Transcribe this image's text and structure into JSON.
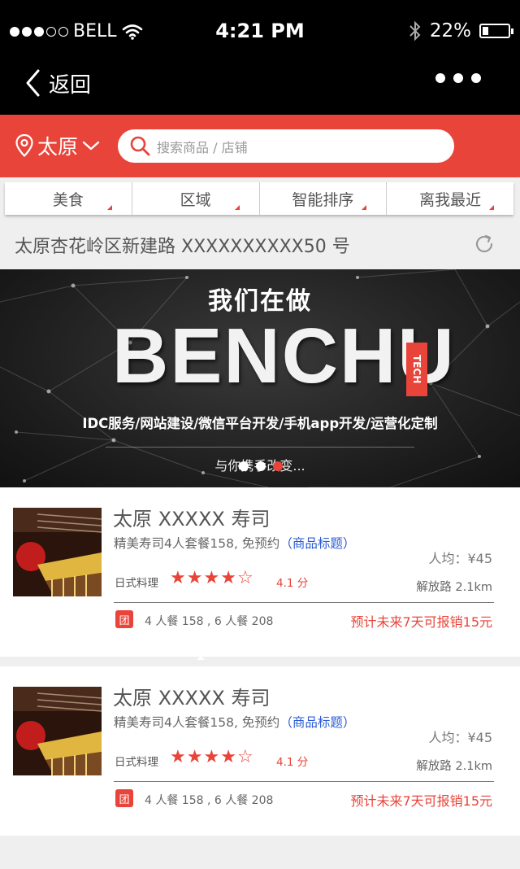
{
  "status_bar": {
    "carrier": "BELL",
    "time": "4:21 PM",
    "battery": "22%",
    "battery_level": 0.22
  },
  "nav": {
    "back_label": "返回"
  },
  "header": {
    "city": "太原",
    "search_placeholder": "搜索商品 / 店铺",
    "accent_color": "#e8443a"
  },
  "filters": [
    "美食",
    "区域",
    "智能排序",
    "离我最近"
  ],
  "address": "太原杏花岭区新建路 XXXXXXXXXX50 号",
  "banner": {
    "headline": "我们在做",
    "logo": "BENCHU",
    "logo_tag": "TECH",
    "services": "IDC服务/网站建设/微信平台开发/手机app开发/运营化定制",
    "slogan": "与你携手改变...",
    "active_slide": 3,
    "slide_count": 3
  },
  "listings": [
    {
      "name": "太原 XXXXX 寿司",
      "desc": "精美寿司4人套餐158, 免预约",
      "tag": "（商品标题）",
      "price": "人均：¥45",
      "category": "日式料理",
      "rating": 4,
      "rating_max": 5,
      "score": "4.1 分",
      "distance": "解放路 2.1km",
      "badge": "团",
      "deals": "4 人餐 158 , 6 人餐 208",
      "reimburse": "预计未来7天可报销15元"
    },
    {
      "name": "太原 XXXXX 寿司",
      "desc": "精美寿司4人套餐158, 免预约",
      "tag": "（商品标题）",
      "price": "人均：¥45",
      "category": "日式料理",
      "rating": 4,
      "rating_max": 5,
      "score": "4.1 分",
      "distance": "解放路 2.1km",
      "badge": "团",
      "deals": "4 人餐 158 , 6 人餐 208",
      "reimburse": "预计未来7天可报销15元"
    }
  ]
}
